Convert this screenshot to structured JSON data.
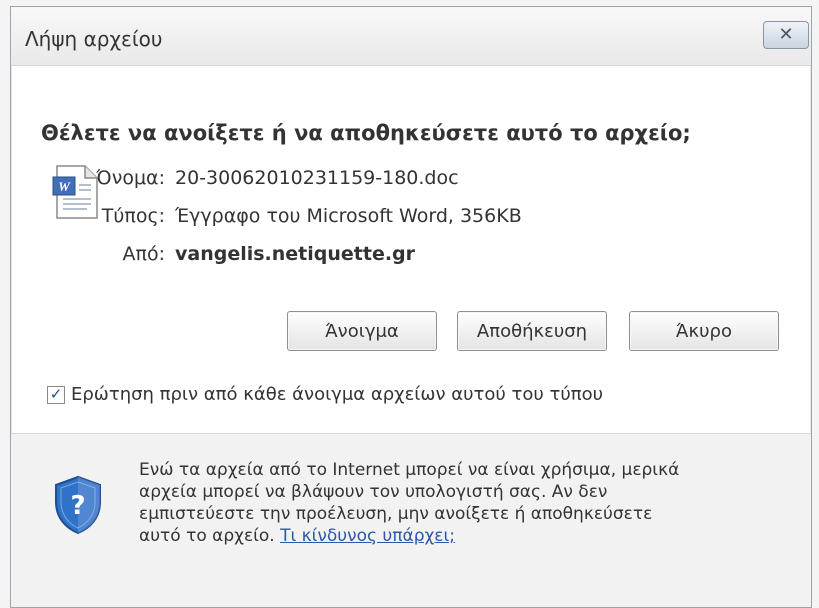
{
  "dialog": {
    "title": "Λήψη αρχείου",
    "question": "Θέλετε να ανοίξετε ή να αποθηκεύσετε αυτό το αρχείο;"
  },
  "file": {
    "icon": "word-doc-icon",
    "name_label": "Όνομα:",
    "name_value": "20-30062010231159-180.doc",
    "type_label": "Τύπος:",
    "type_value": "Έγγραφο του Microsoft Word, 356KB",
    "from_label": "Από:",
    "from_value": "vangelis.netiquette.gr"
  },
  "buttons": {
    "open": "Άνοιγμα",
    "save": "Αποθήκευση",
    "cancel": "Άκυρο"
  },
  "checkbox": {
    "label": "Ερώτηση πριν από κάθε άνοιγμα αρχείων αυτού του τύπου",
    "checked": true
  },
  "warning": {
    "icon": "shield-question-icon",
    "line1": "Ενώ τα αρχεία από το Internet μπορεί να είναι χρήσιμα, μερικά",
    "line2": "αρχεία μπορεί να βλάψουν τον υπολογιστή σας. Αν δεν",
    "line3": "εμπιστεύεστε την προέλευση, μην ανοίξετε ή αποθηκεύσετε",
    "line4_text": "αυτό το αρχείο.",
    "link": "Τι κίνδυνος υπάρχει;"
  },
  "colors": {
    "link": "#2d56a8",
    "checkmark": "#1d4f8f",
    "shield": "#2f73c9"
  }
}
